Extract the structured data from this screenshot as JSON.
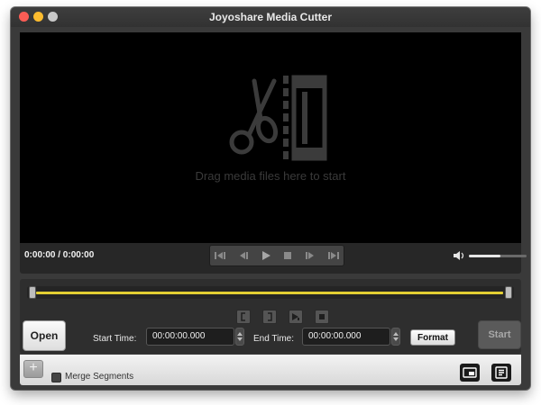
{
  "window": {
    "title": "Joyoshare Media Cutter"
  },
  "preview": {
    "drop_hint": "Drag media files here to start",
    "time_display": "0:00:00 / 0:00:00",
    "volume_level": 0.55
  },
  "playback": {
    "buttons": [
      "skip-back-icon",
      "step-back-icon",
      "play-icon",
      "stop-icon",
      "step-forward-icon",
      "skip-forward-icon"
    ]
  },
  "segment_tools": {
    "buttons": [
      "mark-start-icon",
      "mark-end-icon",
      "preview-segment-icon",
      "stop-icon"
    ]
  },
  "editor": {
    "open_label": "Open",
    "start_time_label": "Start Time:",
    "start_time_value": "00:00:00.000",
    "end_time_label": "End Time:",
    "end_time_value": "00:00:00.000",
    "format_label": "Format",
    "start_label": "Start"
  },
  "bottom": {
    "add_label": "+",
    "merge_label": "Merge Segments",
    "merge_checked": false,
    "icons": [
      "output-folder-icon",
      "task-list-icon"
    ]
  },
  "colors": {
    "timeline_accent": "#e3cf33",
    "close": "#fc5d55",
    "minimize": "#fdbc2f"
  }
}
